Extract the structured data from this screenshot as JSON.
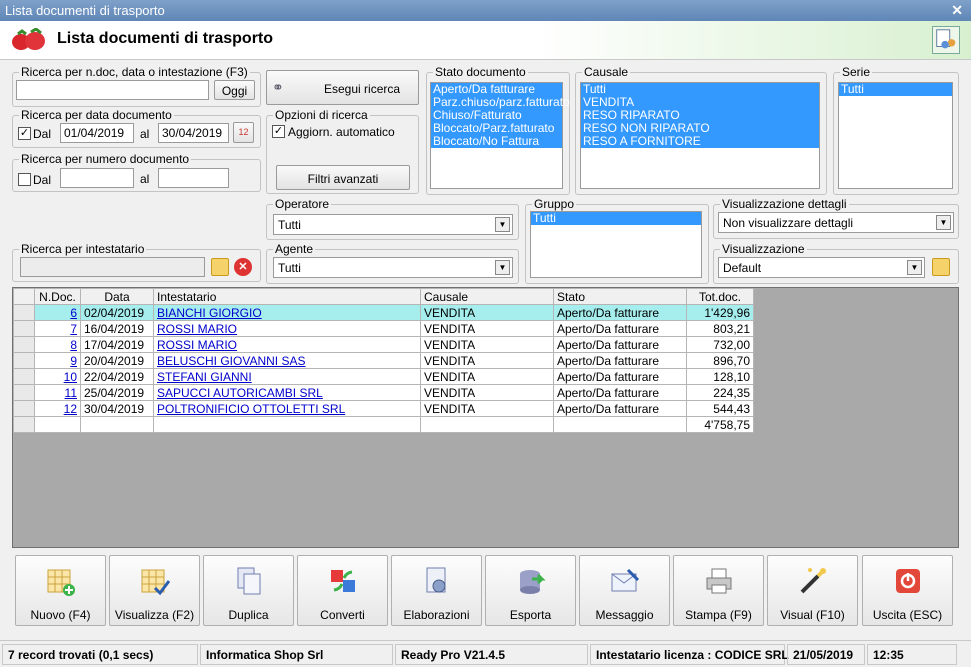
{
  "window": {
    "title": "Lista documenti di trasporto",
    "header": "Lista documenti di trasporto"
  },
  "search": {
    "quick_legend": "Ricerca per n.doc, data o intestazione (F3)",
    "quick_value": "",
    "oggi": "Oggi",
    "date_legend": "Ricerca per data documento",
    "date_dal": "Dal",
    "date_from": "01/04/2019",
    "date_al": "al",
    "date_to": "30/04/2019",
    "num_legend": "Ricerca per numero documento",
    "num_dal": "Dal",
    "num_from": "",
    "num_al": "al",
    "num_to": "",
    "holder_legend": "Ricerca per intestatario",
    "holder_value": "",
    "run": "Esegui ricerca",
    "opts_legend": "Opzioni di ricerca",
    "auto": "Aggiorn. automatico",
    "advanced": "Filtri avanzati"
  },
  "stato": {
    "legend": "Stato documento",
    "items": [
      "Aperto/Da fatturare",
      "Parz.chiuso/parz.fatturato",
      "Chiuso/Fatturato",
      "Bloccato/Parz.fatturato",
      "Bloccato/No Fattura"
    ]
  },
  "causale": {
    "legend": "Causale",
    "items": [
      "Tutti",
      "VENDITA",
      "RESO RIPARATO",
      "RESO NON RIPARATO",
      "RESO A FORNITORE"
    ]
  },
  "serie": {
    "legend": "Serie",
    "items": [
      "Tutti"
    ]
  },
  "operatore": {
    "legend": "Operatore",
    "value": "Tutti"
  },
  "agente": {
    "legend": "Agente",
    "value": "Tutti"
  },
  "gruppo": {
    "legend": "Gruppo",
    "items": [
      "Tutti"
    ]
  },
  "dettagli": {
    "legend": "Visualizzazione dettagli",
    "value": "Non visualizzare dettagli"
  },
  "visual": {
    "legend": "Visualizzazione",
    "value": "Default"
  },
  "grid": {
    "headers": [
      "N.Doc.",
      "Data",
      "Intestatario",
      "Causale",
      "Stato",
      "Tot.doc."
    ],
    "rows": [
      [
        "6",
        "02/04/2019",
        "BIANCHI GIORGIO",
        "VENDITA",
        "Aperto/Da fatturare",
        "1'429,96"
      ],
      [
        "7",
        "16/04/2019",
        "ROSSI MARIO",
        "VENDITA",
        "Aperto/Da fatturare",
        "803,21"
      ],
      [
        "8",
        "17/04/2019",
        "ROSSI MARIO",
        "VENDITA",
        "Aperto/Da fatturare",
        "732,00"
      ],
      [
        "9",
        "20/04/2019",
        "BELUSCHI GIOVANNI SAS",
        "VENDITA",
        "Aperto/Da fatturare",
        "896,70"
      ],
      [
        "10",
        "22/04/2019",
        "STEFANI GIANNI",
        "VENDITA",
        "Aperto/Da fatturare",
        "128,10"
      ],
      [
        "11",
        "25/04/2019",
        "SAPUCCI AUTORICAMBI SRL",
        "VENDITA",
        "Aperto/Da fatturare",
        "224,35"
      ],
      [
        "12",
        "30/04/2019",
        "POLTRONIFICIO OTTOLETTI SRL",
        "VENDITA",
        "Aperto/Da fatturare",
        "544,43"
      ]
    ],
    "total": "4'758,75"
  },
  "toolbar": [
    {
      "label": "Nuovo (F4)",
      "icon": "new-doc-icon"
    },
    {
      "label": "Visualizza (F2)",
      "icon": "view-doc-icon"
    },
    {
      "label": "Duplica",
      "icon": "duplicate-icon"
    },
    {
      "label": "Converti",
      "icon": "convert-icon"
    },
    {
      "label": "Elaborazioni",
      "icon": "process-icon"
    },
    {
      "label": "Esporta",
      "icon": "export-icon"
    },
    {
      "label": "Messaggio",
      "icon": "message-icon"
    },
    {
      "label": "Stampa (F9)",
      "icon": "print-icon"
    },
    {
      "label": "Visual (F10)",
      "icon": "magic-wand-icon"
    },
    {
      "label": "Uscita (ESC)",
      "icon": "exit-icon"
    }
  ],
  "status": {
    "records": "7 record trovati (0,1 secs)",
    "company": "Informatica Shop Srl",
    "version": "Ready Pro V21.4.5",
    "license": "Intestatario licenza : CODICE SRL",
    "date": "21/05/2019",
    "time": "12:35"
  }
}
